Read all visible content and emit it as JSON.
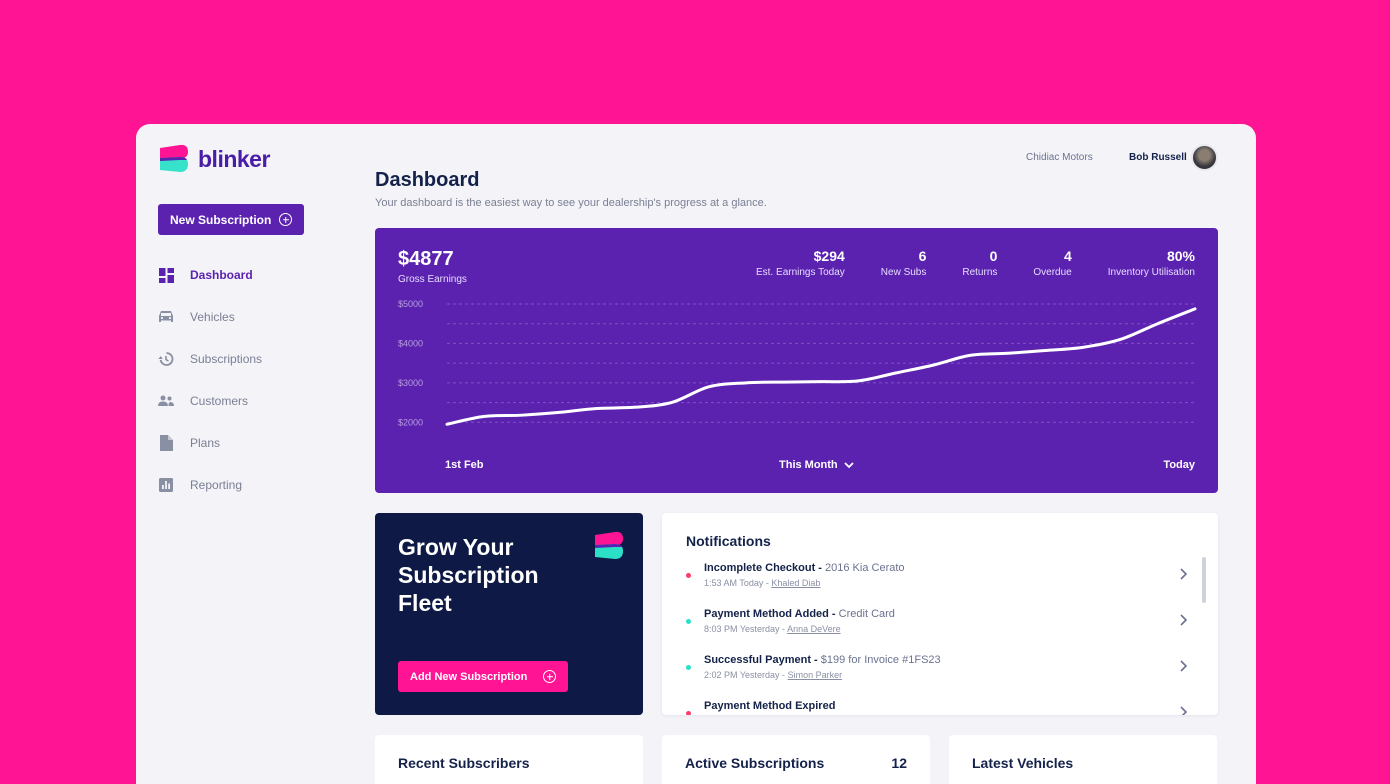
{
  "brand": {
    "name": "blinker",
    "accent": "#5B22B0",
    "pink": "#FF1493",
    "teal": "#2CE0C8",
    "navy": "#0E1A45"
  },
  "sidebar": {
    "new_button": "New Subscription",
    "items": [
      {
        "label": "Dashboard",
        "icon": "dashboard-icon",
        "active": true
      },
      {
        "label": "Vehicles",
        "icon": "car-icon",
        "active": false
      },
      {
        "label": "Subscriptions",
        "icon": "history-icon",
        "active": false
      },
      {
        "label": "Customers",
        "icon": "people-icon",
        "active": false
      },
      {
        "label": "Plans",
        "icon": "document-icon",
        "active": false
      },
      {
        "label": "Reporting",
        "icon": "chart-icon",
        "active": false
      }
    ]
  },
  "header": {
    "dealer": "Chidiac Motors",
    "user": "Bob Russell"
  },
  "page": {
    "title": "Dashboard",
    "subtitle": "Your dashboard is the easiest way to see your dealership's progress at a glance."
  },
  "earnings": {
    "gross_value": "$4877",
    "gross_label": "Gross Earnings",
    "stats": [
      {
        "value": "$294",
        "label": "Est. Earnings Today"
      },
      {
        "value": "6",
        "label": "New Subs"
      },
      {
        "value": "0",
        "label": "Returns"
      },
      {
        "value": "4",
        "label": "Overdue"
      },
      {
        "value": "80%",
        "label": "Inventory Utilisation"
      }
    ],
    "x_start": "1st Feb",
    "period": "This Month",
    "x_end": "Today"
  },
  "chart_data": {
    "type": "line",
    "title": "",
    "ylabel": "",
    "ylim": [
      1500,
      5000
    ],
    "yticks": [
      2000,
      3000,
      4000,
      5000
    ],
    "ytick_labels": [
      "$2000",
      "$3000",
      "$4000",
      "$5000"
    ],
    "x": [
      0,
      0.05,
      0.1,
      0.15,
      0.2,
      0.25,
      0.3,
      0.35,
      0.4,
      0.45,
      0.5,
      0.55,
      0.6,
      0.65,
      0.7,
      0.75,
      0.8,
      0.85,
      0.9,
      0.95,
      1.0
    ],
    "values": [
      1950,
      2150,
      2180,
      2250,
      2350,
      2380,
      2500,
      2900,
      3000,
      3020,
      3030,
      3050,
      3250,
      3450,
      3700,
      3750,
      3820,
      3900,
      4100,
      4500,
      4877
    ],
    "grid": true
  },
  "grow": {
    "title": "Grow Your Subscription Fleet",
    "button": "Add New Subscription"
  },
  "notifications": {
    "title": "Notifications",
    "items": [
      {
        "title": "Incomplete Checkout -",
        "detail": "2016 Kia Cerato",
        "time": "1:53 AM Today -",
        "person": "Khaled Diab",
        "color": "#FF3B6B"
      },
      {
        "title": "Payment Method Added -",
        "detail": "Credit Card",
        "time": "8:03 PM Yesterday -",
        "person": "Anna DeVere",
        "color": "#2CE0C8"
      },
      {
        "title": "Successful Payment -",
        "detail": "$199 for Invoice #1FS23",
        "time": "2:02 PM Yesterday -",
        "person": "Simon Parker",
        "color": "#2CE0C8"
      },
      {
        "title": "Payment Method Expired",
        "detail": "",
        "time": "",
        "person": "",
        "color": "#FF3B6B"
      }
    ]
  },
  "bottom_cards": [
    {
      "title": "Recent Subscribers",
      "count": ""
    },
    {
      "title": "Active Subscriptions",
      "count": "12"
    },
    {
      "title": "Latest Vehicles",
      "count": ""
    }
  ]
}
